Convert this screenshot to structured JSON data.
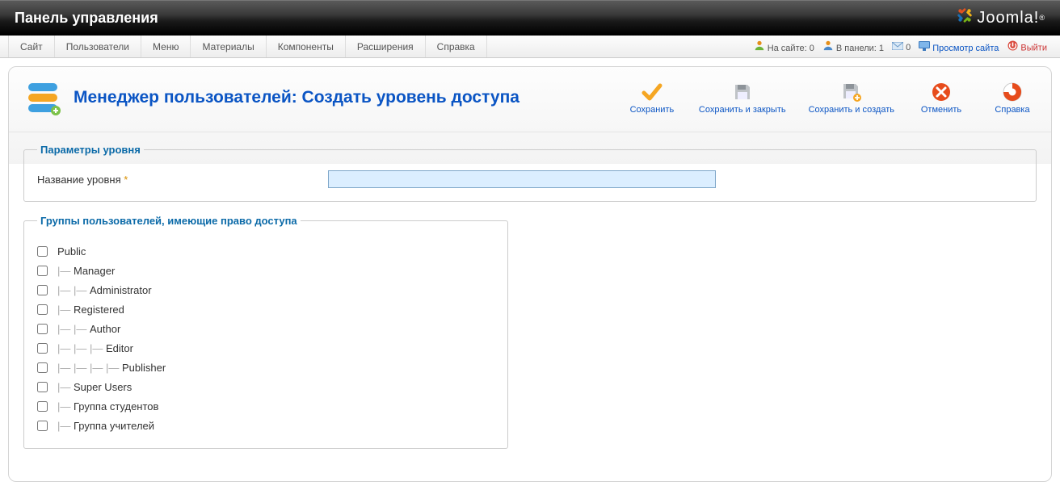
{
  "titlebar": {
    "title": "Панель управления",
    "brand": "Joomla!"
  },
  "menu": {
    "items": [
      "Сайт",
      "Пользователи",
      "Меню",
      "Материалы",
      "Компоненты",
      "Расширения",
      "Справка"
    ]
  },
  "status": {
    "on_site_label": "На сайте:",
    "on_site_count": "0",
    "in_panel_label": "В панели:",
    "in_panel_count": "1",
    "messages_count": "0",
    "view_site": "Просмотр сайта",
    "logout": "Выйти"
  },
  "page": {
    "title": "Менеджер пользователей: Создать уровень доступа"
  },
  "toolbar": {
    "save": "Сохранить",
    "save_close": "Сохранить и закрыть",
    "save_new": "Сохранить и создать",
    "cancel": "Отменить",
    "help": "Справка"
  },
  "fieldset_level": {
    "legend": "Параметры уровня",
    "name_label": "Название уровня",
    "name_value": ""
  },
  "fieldset_groups": {
    "legend": "Группы пользователей, имеющие право доступа",
    "items": [
      {
        "label": "Public",
        "depth": 0
      },
      {
        "label": "Manager",
        "depth": 1
      },
      {
        "label": "Administrator",
        "depth": 2
      },
      {
        "label": "Registered",
        "depth": 1
      },
      {
        "label": "Author",
        "depth": 2
      },
      {
        "label": "Editor",
        "depth": 3
      },
      {
        "label": "Publisher",
        "depth": 4
      },
      {
        "label": "Super Users",
        "depth": 1
      },
      {
        "label": "Группа студентов",
        "depth": 1
      },
      {
        "label": "Группа учителей",
        "depth": 1
      }
    ]
  }
}
